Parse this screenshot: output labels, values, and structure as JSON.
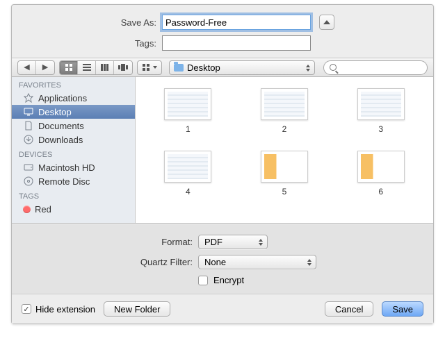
{
  "top": {
    "save_as_label": "Save As:",
    "save_as_value": "Password-Free",
    "tags_label": "Tags:",
    "tags_value": ""
  },
  "toolbar": {
    "location_label": "Desktop",
    "search_placeholder": ""
  },
  "sidebar": {
    "headers": {
      "favorites": "FAVORITES",
      "devices": "DEVICES",
      "tags": "TAGS"
    },
    "favorites": [
      {
        "icon": "applications",
        "label": "Applications"
      },
      {
        "icon": "desktop",
        "label": "Desktop",
        "selected": true
      },
      {
        "icon": "documents",
        "label": "Documents"
      },
      {
        "icon": "downloads",
        "label": "Downloads"
      }
    ],
    "devices": [
      {
        "icon": "hd",
        "label": "Macintosh HD"
      },
      {
        "icon": "disc",
        "label": "Remote Disc"
      }
    ],
    "tags": [
      {
        "color": "#ff6b6b",
        "label": "Red"
      }
    ]
  },
  "content": {
    "items": [
      {
        "label": "1"
      },
      {
        "label": "2"
      },
      {
        "label": "3"
      },
      {
        "label": "4"
      },
      {
        "label": "5"
      },
      {
        "label": "6"
      }
    ]
  },
  "options": {
    "format_label": "Format:",
    "format_value": "PDF",
    "quartz_label": "Quartz Filter:",
    "quartz_value": "None",
    "encrypt_label": "Encrypt",
    "encrypt_checked": false
  },
  "buttons": {
    "hide_ext_label": "Hide extension",
    "hide_ext_checked": true,
    "new_folder": "New Folder",
    "cancel": "Cancel",
    "save": "Save"
  }
}
